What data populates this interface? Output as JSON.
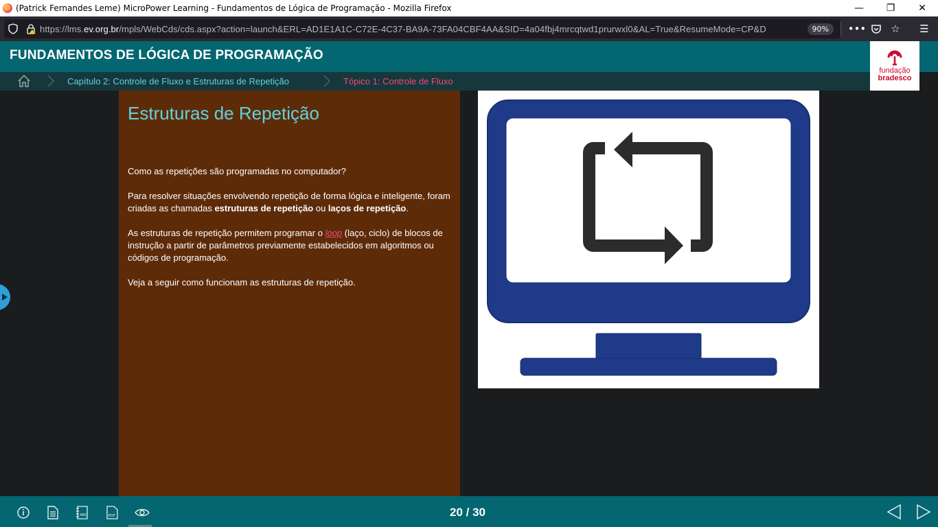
{
  "browser": {
    "window_title": "(Patrick Fernandes Leme) MicroPower Learning - Fundamentos de Lógica de Programação - Mozilla Firefox",
    "url_prefix": "https://lms.",
    "url_host": "ev.org.br",
    "url_rest": "/mpls/WebCds/cds.aspx?action=launch&ERL=AD1E1A1C-C72E-4C37-BA9A-73FA04CBF4AA&SID=4a04fbj4mrcqtwd1prurwxl0&AL=True&ResumeMode=CP&D",
    "zoom_level": "90%"
  },
  "course": {
    "title": "FUNDAMENTOS DE LÓGICA DE PROGRAMAÇÃO",
    "logo_line1": "fundação",
    "logo_line2": "bradesco"
  },
  "breadcrumb": {
    "chapter": "Capítulo 2: Controle de Fluxo e Estruturas de Repetição",
    "topic": "Tópico 1: Controle de Fluxo"
  },
  "slide": {
    "title": "Estruturas de Repetição",
    "p1": "Como as repetições são programadas no computador?",
    "p2_a": "Para resolver situações envolvendo repetição de forma lógica e inteligente, foram criadas as chamadas ",
    "p2_b": "estruturas de repetição",
    "p2_c": " ou ",
    "p2_d": "laços de repetição",
    "p2_e": ".",
    "p3_a": "As estruturas de repetição permitem programar o ",
    "p3_link": "loop",
    "p3_b": " (laço, ciclo) de blocos de instrução a partir de parâmetros previamente estabelecidos em algoritmos ou códigos de programação.",
    "p4": "Veja a seguir como funcionam as estruturas de repetição."
  },
  "footer": {
    "page_counter": "20 / 30"
  },
  "colors": {
    "header_teal": "#046670",
    "panel_brown": "#5e2b09",
    "title_cyan": "#5fd3de",
    "accent_pink": "#f0487c",
    "monitor_blue": "#203a8a",
    "brand_red": "#cc092f"
  }
}
